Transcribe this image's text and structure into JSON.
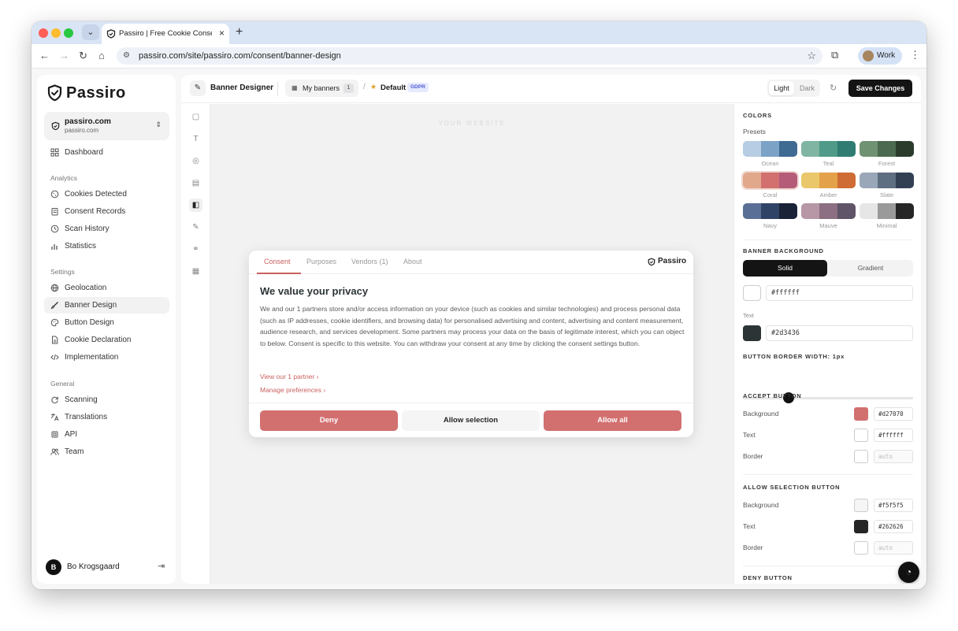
{
  "browser": {
    "tab_title": "Passiro | Free Cookie Consent",
    "url": "passiro.com/site/passiro.com/consent/banner-design",
    "profile_label": "Work"
  },
  "sidebar": {
    "brand": "Passiro",
    "site_name": "passiro.com",
    "site_sub": "passiro.com",
    "dashboard": "Dashboard",
    "sections": {
      "analytics": "Analytics",
      "settings": "Settings",
      "general": "General"
    },
    "analytics_items": [
      {
        "label": "Cookies Detected",
        "icon": "cookie-icon"
      },
      {
        "label": "Consent Records",
        "icon": "records-icon"
      },
      {
        "label": "Scan History",
        "icon": "clock-icon"
      },
      {
        "label": "Statistics",
        "icon": "chart-icon"
      }
    ],
    "settings_items": [
      {
        "label": "Geolocation",
        "icon": "globe-icon"
      },
      {
        "label": "Banner Design",
        "icon": "brush-icon"
      },
      {
        "label": "Button Design",
        "icon": "palette-icon"
      },
      {
        "label": "Cookie Declaration",
        "icon": "document-icon"
      },
      {
        "label": "Implementation",
        "icon": "code-icon"
      }
    ],
    "general_items": [
      {
        "label": "Scanning",
        "icon": "refresh-icon"
      },
      {
        "label": "Translations",
        "icon": "translate-icon"
      },
      {
        "label": "API",
        "icon": "api-icon"
      },
      {
        "label": "Team",
        "icon": "team-icon"
      }
    ],
    "user_initial": "B",
    "user_name": "Bo Krogsgaard"
  },
  "topbar": {
    "title": "Banner Designer",
    "my_banners": "My banners",
    "my_banners_count": "1",
    "default_label": "Default",
    "badge": "GDPR",
    "light": "Light",
    "dark": "Dark",
    "save": "Save Changes"
  },
  "canvas": {
    "watermark": "YOUR WEBSITE"
  },
  "banner": {
    "tabs": [
      "Consent",
      "Purposes",
      "Vendors (1)",
      "About"
    ],
    "brand": "Passiro",
    "heading": "We value your privacy",
    "body": "We and our 1 partners store and/or access information on your device (such as cookies and similar technologies) and process personal data (such as IP addresses, cookie identifiers, and browsing data) for personalised advertising and content, advertising and content measurement, audience research, and services development. Some partners may process your data on the basis of legitimate interest, which you can object to below. Consent is specific to this website. You can withdraw your consent at any time by clicking the consent settings button.",
    "link_partner": "View our 1 partner ›",
    "link_manage": "Manage preferences ›",
    "deny": "Deny",
    "allow_selection": "Allow selection",
    "allow_all": "Allow all"
  },
  "panel": {
    "colors_title": "COLORS",
    "presets_label": "Presets",
    "presets": [
      {
        "name": "Ocean",
        "colors": [
          "#b7cde3",
          "#7ca3c6",
          "#3f6a92"
        ]
      },
      {
        "name": "Teal",
        "colors": [
          "#7fb5a2",
          "#4f9a88",
          "#2f7d72"
        ]
      },
      {
        "name": "Forest",
        "colors": [
          "#6f9273",
          "#4c6a4f",
          "#2b3c2d"
        ]
      },
      {
        "name": "Coral",
        "colors": [
          "#e2a88c",
          "#d27070",
          "#b55d78"
        ]
      },
      {
        "name": "Amber",
        "colors": [
          "#ebc76b",
          "#e3a24a",
          "#cf6c35"
        ]
      },
      {
        "name": "Slate",
        "colors": [
          "#9aa7b8",
          "#5f6f82",
          "#334054"
        ]
      },
      {
        "name": "Navy",
        "colors": [
          "#5a6f95",
          "#2f4366",
          "#1a2238"
        ]
      },
      {
        "name": "Mauve",
        "colors": [
          "#b797a6",
          "#8c6f82",
          "#5f5468"
        ]
      },
      {
        "name": "Minimal",
        "colors": [
          "#e6e6e6",
          "#9a9a9a",
          "#262626"
        ]
      }
    ],
    "banner_bg_title": "BANNER BACKGROUND",
    "solid": "Solid",
    "gradient": "Gradient",
    "bg_color": "#ffffff",
    "text_label": "Text",
    "text_color": "#2d3436",
    "border_width_title": "BUTTON BORDER WIDTH: 1px",
    "border_width_value": 1,
    "accept_title": "ACCEPT BUTTON",
    "accept": {
      "background": "#d27070",
      "text": "#ffffff",
      "border": "auto"
    },
    "allow_sel_title": "ALLOW SELECTION BUTTON",
    "allow_sel": {
      "background": "#f5f5f5",
      "text": "#262626",
      "border": "auto"
    },
    "deny_title": "DENY BUTTON",
    "labels": {
      "background": "Background",
      "text": "Text",
      "border": "Border"
    }
  }
}
